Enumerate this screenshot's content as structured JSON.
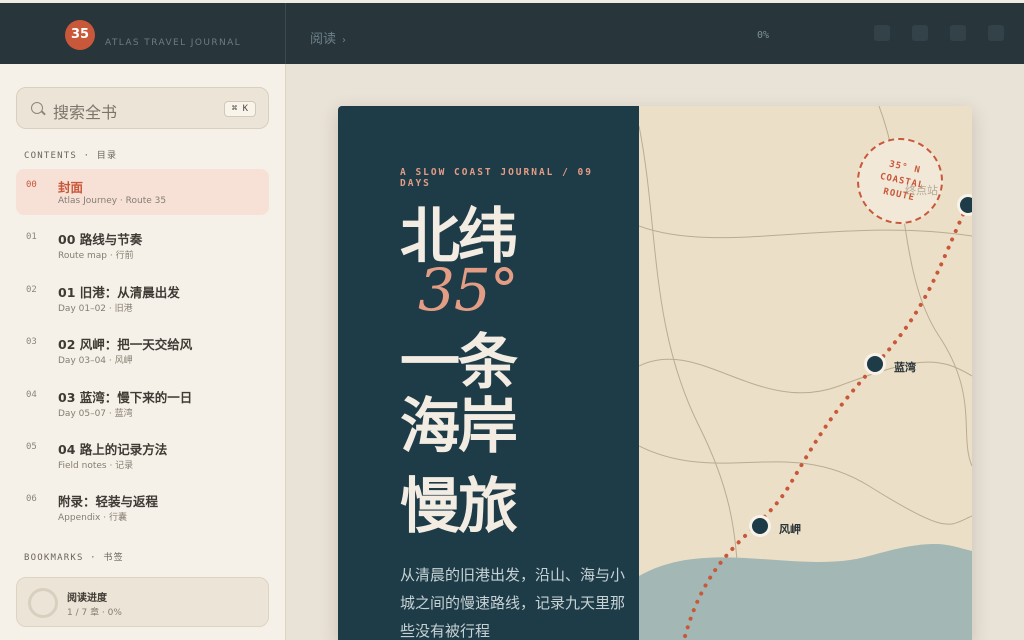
{
  "brand": {
    "badge": "35",
    "name": "ATLAS TRAVEL JOURNAL"
  },
  "breadcrumb": {
    "root": "阅读",
    "separator": "›"
  },
  "progress_percent_label": "0%",
  "search": {
    "placeholder": "搜索全书",
    "shortcut": "⌘ K"
  },
  "contents_heading": "CONTENTS · 目录",
  "toc": [
    {
      "num": "00",
      "title": "封面",
      "sub": "Atlas Journey · Route 35",
      "active": true
    },
    {
      "num": "01",
      "title": "00 路线与节奏",
      "sub": "Route map · 行前"
    },
    {
      "num": "02",
      "title": "01 旧港：从清晨出发",
      "sub": "Day 01–02 · 旧港"
    },
    {
      "num": "03",
      "title": "02 风岬：把一天交给风",
      "sub": "Day 03–04 · 风岬"
    },
    {
      "num": "04",
      "title": "03 蓝湾：慢下来的一日",
      "sub": "Day 05–07 · 蓝湾"
    },
    {
      "num": "05",
      "title": "04 路上的记录方法",
      "sub": "Field notes · 记录"
    },
    {
      "num": "06",
      "title": "附录：轻装与返程",
      "sub": "Appendix · 行囊"
    }
  ],
  "bookmarks_heading": "BOOKMARKS · 书签",
  "reading_progress": {
    "title": "阅读进度",
    "sub": "1 / 7 章 · 0%",
    "value": 0
  },
  "cover": {
    "kicker": "A SLOW COAST JOURNAL / 09 DAYS",
    "title_line1": "北纬",
    "title_num": "35°",
    "title_line2": "一条",
    "title_line3": "海岸",
    "title_line4": "慢旅",
    "blurb": "从清晨的旧港出发，沿山、海与小城之间的慢速路线，记录九天里那些没有被行程",
    "stamp": [
      "35° N",
      "COASTAL",
      "ROUTE"
    ],
    "stamp_overlap": "终点站",
    "cities": [
      "蓝湾",
      "风岬"
    ]
  },
  "colors": {
    "accent": "#c9573a",
    "navy": "#1e3b48",
    "paper": "#ecdfc7"
  }
}
